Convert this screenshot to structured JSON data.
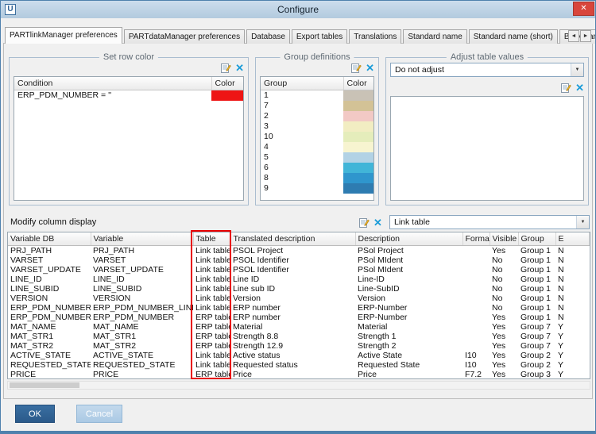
{
  "window": {
    "title": "Configure"
  },
  "titlebar": {
    "app_glyph": "U",
    "close_glyph": "✕"
  },
  "icons": {
    "clear": "✕",
    "combo_arrow": "▼",
    "scroll_left": "◄",
    "scroll_right": "►"
  },
  "tabs": [
    {
      "label": "PARTlinkManager preferences",
      "active": true
    },
    {
      "label": "PARTdataManager preferences",
      "active": false
    },
    {
      "label": "Database",
      "active": false
    },
    {
      "label": "Export tables",
      "active": false
    },
    {
      "label": "Translations",
      "active": false
    },
    {
      "label": "Standard name",
      "active": false
    },
    {
      "label": "Standard name (short)",
      "active": false
    },
    {
      "label": "BOM name",
      "active": false
    }
  ],
  "set_row_color": {
    "title": "Set row color",
    "columns": [
      "Condition",
      "Color"
    ],
    "rows": [
      {
        "condition": "ERP_PDM_NUMBER = ''",
        "color": "#ee1515"
      }
    ]
  },
  "group_definitions": {
    "title": "Group definitions",
    "columns": [
      "Group",
      "Color"
    ],
    "rows": [
      {
        "group": "1",
        "color": "#c9c2b6"
      },
      {
        "group": "7",
        "color": "#d3c296"
      },
      {
        "group": "2",
        "color": "#f2c9c5"
      },
      {
        "group": "3",
        "color": "#f2edc2"
      },
      {
        "group": "10",
        "color": "#e5edbb"
      },
      {
        "group": "4",
        "color": "#f7f4d0"
      },
      {
        "group": "5",
        "color": "#b2d2e5"
      },
      {
        "group": "6",
        "color": "#41b5d8"
      },
      {
        "group": "8",
        "color": "#2f96cd"
      },
      {
        "group": "9",
        "color": "#2e7cb1"
      }
    ]
  },
  "adjust_table_values": {
    "title": "Adjust table values",
    "selected": "Do not adjust"
  },
  "modify_column_display": {
    "label": "Modify column display",
    "selected_table": "Link table",
    "highlight": {
      "column": "Table",
      "color": "#e80000"
    },
    "columns": [
      "Variable DB",
      "Variable",
      "Table",
      "Translated description",
      "Description",
      "Format",
      "Visible",
      "Group",
      "E"
    ],
    "rows": [
      [
        "PRJ_PATH",
        "PRJ_PATH",
        "Link table",
        "PSOL Project",
        "PSol Project",
        "",
        "Yes",
        "Group 1",
        "N"
      ],
      [
        "VARSET",
        "VARSET",
        "Link table",
        "PSOL Identifier",
        "PSol MIdent",
        "",
        "No",
        "Group 1",
        "N"
      ],
      [
        "VARSET_UPDATE",
        "VARSET_UPDATE",
        "Link table",
        "PSOL Identifier",
        "PSol MIdent",
        "",
        "No",
        "Group 1",
        "N"
      ],
      [
        "LINE_ID",
        "LINE_ID",
        "Link table",
        "Line ID",
        "Line-ID",
        "",
        "No",
        "Group 1",
        "N"
      ],
      [
        "LINE_SUBID",
        "LINE_SUBID",
        "Link table",
        "Line sub ID",
        "Line-SubID",
        "",
        "No",
        "Group 1",
        "N"
      ],
      [
        "VERSION",
        "VERSION",
        "Link table",
        "Version",
        "Version",
        "",
        "No",
        "Group 1",
        "N"
      ],
      [
        "ERP_PDM_NUMBER",
        "ERP_PDM_NUMBER_LINKTABLE",
        "Link table",
        "ERP number",
        "ERP-Number",
        "",
        "No",
        "Group 1",
        "N"
      ],
      [
        "ERP_PDM_NUMBER",
        "ERP_PDM_NUMBER",
        "ERP table",
        "ERP number",
        "ERP-Number",
        "",
        "Yes",
        "Group 1",
        "N"
      ],
      [
        "MAT_NAME",
        "MAT_NAME",
        "ERP table",
        "Material",
        "Material",
        "",
        "Yes",
        "Group 7",
        "Y"
      ],
      [
        "MAT_STR1",
        "MAT_STR1",
        "ERP table",
        "Strength 8.8",
        "Strength 1",
        "",
        "Yes",
        "Group 7",
        "Y"
      ],
      [
        "MAT_STR2",
        "MAT_STR2",
        "ERP table",
        "Strength 12.9",
        "Strength 2",
        "",
        "Yes",
        "Group 7",
        "Y"
      ],
      [
        "ACTIVE_STATE",
        "ACTIVE_STATE",
        "Link table",
        "Active status",
        "Active State",
        "I10",
        "Yes",
        "Group 2",
        "Y"
      ],
      [
        "REQUESTED_STATE",
        "REQUESTED_STATE",
        "Link table",
        "Requested status",
        "Requested State",
        "I10",
        "Yes",
        "Group 2",
        "Y"
      ],
      [
        "PRICE",
        "PRICE",
        "ERP table",
        "Price",
        "Price",
        "F7.2",
        "Yes",
        "Group 3",
        "Y"
      ]
    ]
  },
  "footer": {
    "ok": "OK",
    "cancel": "Cancel"
  }
}
